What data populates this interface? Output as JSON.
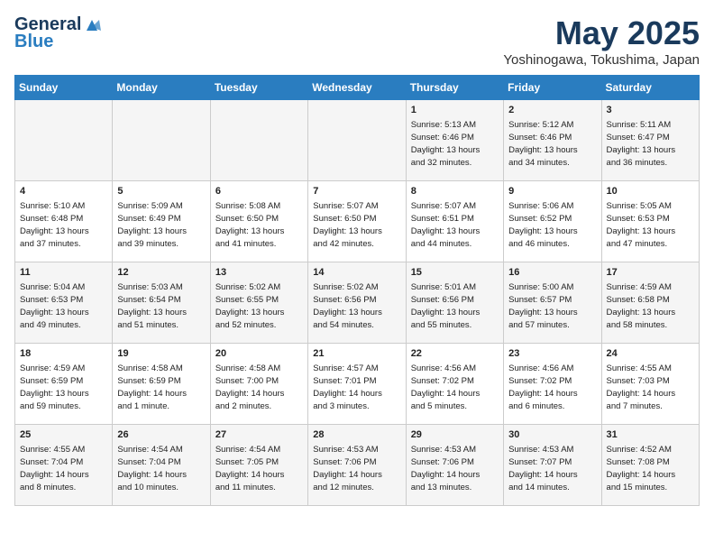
{
  "header": {
    "logo_line1": "General",
    "logo_line2": "Blue",
    "month": "May 2025",
    "location": "Yoshinogawa, Tokushima, Japan"
  },
  "weekdays": [
    "Sunday",
    "Monday",
    "Tuesday",
    "Wednesday",
    "Thursday",
    "Friday",
    "Saturday"
  ],
  "weeks": [
    [
      {
        "day": "",
        "info": ""
      },
      {
        "day": "",
        "info": ""
      },
      {
        "day": "",
        "info": ""
      },
      {
        "day": "",
        "info": ""
      },
      {
        "day": "1",
        "info": "Sunrise: 5:13 AM\nSunset: 6:46 PM\nDaylight: 13 hours\nand 32 minutes."
      },
      {
        "day": "2",
        "info": "Sunrise: 5:12 AM\nSunset: 6:46 PM\nDaylight: 13 hours\nand 34 minutes."
      },
      {
        "day": "3",
        "info": "Sunrise: 5:11 AM\nSunset: 6:47 PM\nDaylight: 13 hours\nand 36 minutes."
      }
    ],
    [
      {
        "day": "4",
        "info": "Sunrise: 5:10 AM\nSunset: 6:48 PM\nDaylight: 13 hours\nand 37 minutes."
      },
      {
        "day": "5",
        "info": "Sunrise: 5:09 AM\nSunset: 6:49 PM\nDaylight: 13 hours\nand 39 minutes."
      },
      {
        "day": "6",
        "info": "Sunrise: 5:08 AM\nSunset: 6:50 PM\nDaylight: 13 hours\nand 41 minutes."
      },
      {
        "day": "7",
        "info": "Sunrise: 5:07 AM\nSunset: 6:50 PM\nDaylight: 13 hours\nand 42 minutes."
      },
      {
        "day": "8",
        "info": "Sunrise: 5:07 AM\nSunset: 6:51 PM\nDaylight: 13 hours\nand 44 minutes."
      },
      {
        "day": "9",
        "info": "Sunrise: 5:06 AM\nSunset: 6:52 PM\nDaylight: 13 hours\nand 46 minutes."
      },
      {
        "day": "10",
        "info": "Sunrise: 5:05 AM\nSunset: 6:53 PM\nDaylight: 13 hours\nand 47 minutes."
      }
    ],
    [
      {
        "day": "11",
        "info": "Sunrise: 5:04 AM\nSunset: 6:53 PM\nDaylight: 13 hours\nand 49 minutes."
      },
      {
        "day": "12",
        "info": "Sunrise: 5:03 AM\nSunset: 6:54 PM\nDaylight: 13 hours\nand 51 minutes."
      },
      {
        "day": "13",
        "info": "Sunrise: 5:02 AM\nSunset: 6:55 PM\nDaylight: 13 hours\nand 52 minutes."
      },
      {
        "day": "14",
        "info": "Sunrise: 5:02 AM\nSunset: 6:56 PM\nDaylight: 13 hours\nand 54 minutes."
      },
      {
        "day": "15",
        "info": "Sunrise: 5:01 AM\nSunset: 6:56 PM\nDaylight: 13 hours\nand 55 minutes."
      },
      {
        "day": "16",
        "info": "Sunrise: 5:00 AM\nSunset: 6:57 PM\nDaylight: 13 hours\nand 57 minutes."
      },
      {
        "day": "17",
        "info": "Sunrise: 4:59 AM\nSunset: 6:58 PM\nDaylight: 13 hours\nand 58 minutes."
      }
    ],
    [
      {
        "day": "18",
        "info": "Sunrise: 4:59 AM\nSunset: 6:59 PM\nDaylight: 13 hours\nand 59 minutes."
      },
      {
        "day": "19",
        "info": "Sunrise: 4:58 AM\nSunset: 6:59 PM\nDaylight: 14 hours\nand 1 minute."
      },
      {
        "day": "20",
        "info": "Sunrise: 4:58 AM\nSunset: 7:00 PM\nDaylight: 14 hours\nand 2 minutes."
      },
      {
        "day": "21",
        "info": "Sunrise: 4:57 AM\nSunset: 7:01 PM\nDaylight: 14 hours\nand 3 minutes."
      },
      {
        "day": "22",
        "info": "Sunrise: 4:56 AM\nSunset: 7:02 PM\nDaylight: 14 hours\nand 5 minutes."
      },
      {
        "day": "23",
        "info": "Sunrise: 4:56 AM\nSunset: 7:02 PM\nDaylight: 14 hours\nand 6 minutes."
      },
      {
        "day": "24",
        "info": "Sunrise: 4:55 AM\nSunset: 7:03 PM\nDaylight: 14 hours\nand 7 minutes."
      }
    ],
    [
      {
        "day": "25",
        "info": "Sunrise: 4:55 AM\nSunset: 7:04 PM\nDaylight: 14 hours\nand 8 minutes."
      },
      {
        "day": "26",
        "info": "Sunrise: 4:54 AM\nSunset: 7:04 PM\nDaylight: 14 hours\nand 10 minutes."
      },
      {
        "day": "27",
        "info": "Sunrise: 4:54 AM\nSunset: 7:05 PM\nDaylight: 14 hours\nand 11 minutes."
      },
      {
        "day": "28",
        "info": "Sunrise: 4:53 AM\nSunset: 7:06 PM\nDaylight: 14 hours\nand 12 minutes."
      },
      {
        "day": "29",
        "info": "Sunrise: 4:53 AM\nSunset: 7:06 PM\nDaylight: 14 hours\nand 13 minutes."
      },
      {
        "day": "30",
        "info": "Sunrise: 4:53 AM\nSunset: 7:07 PM\nDaylight: 14 hours\nand 14 minutes."
      },
      {
        "day": "31",
        "info": "Sunrise: 4:52 AM\nSunset: 7:08 PM\nDaylight: 14 hours\nand 15 minutes."
      }
    ]
  ]
}
